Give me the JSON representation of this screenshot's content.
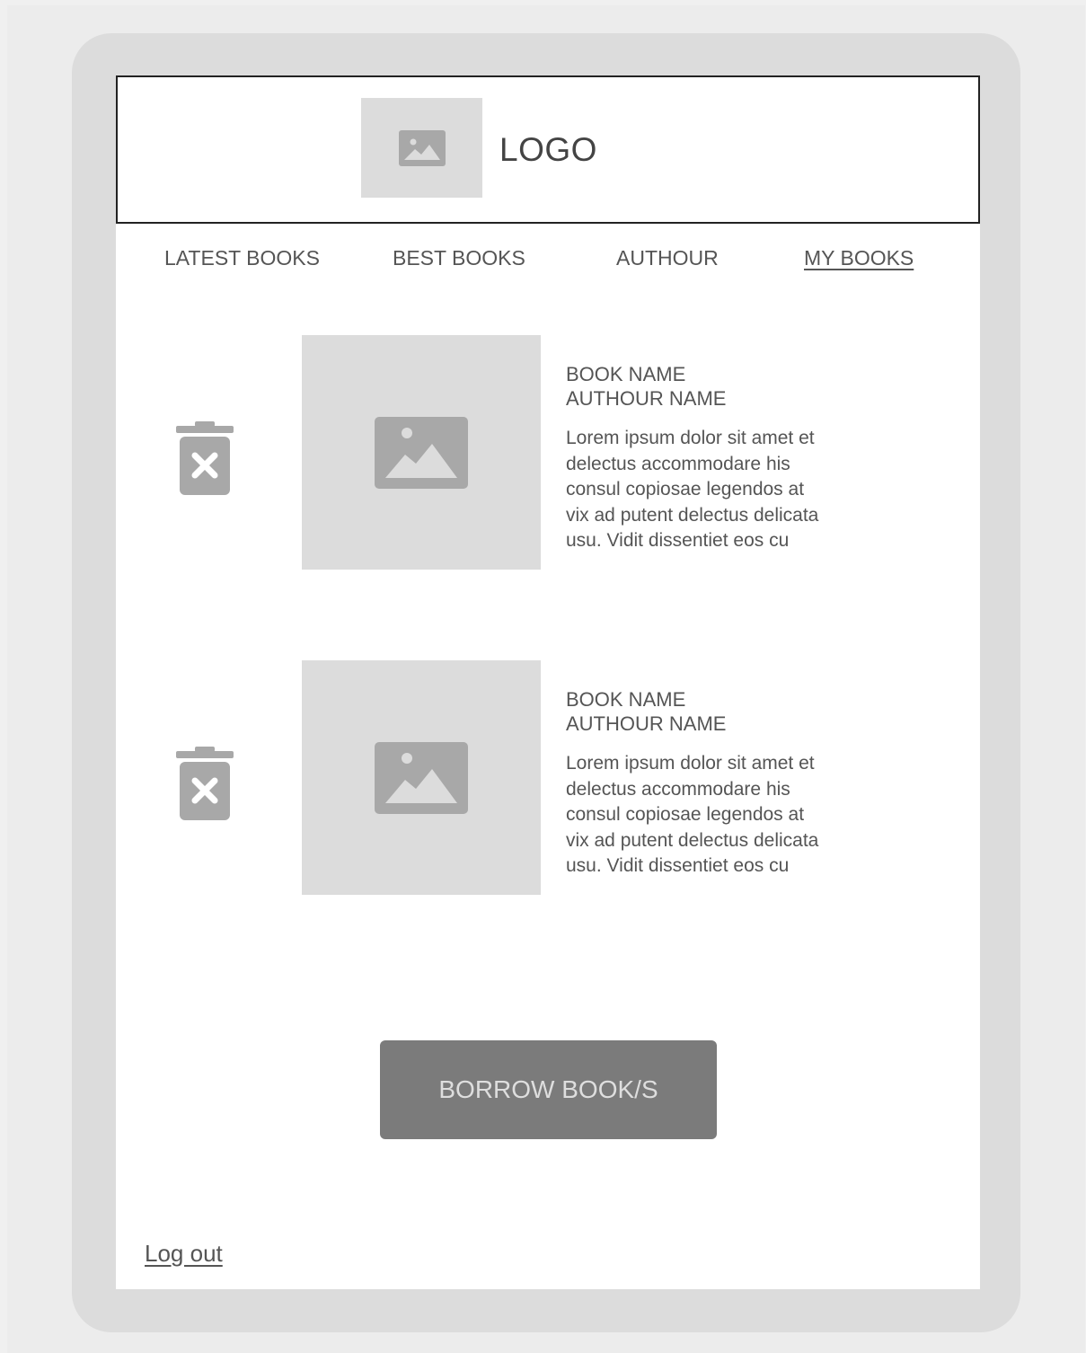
{
  "header": {
    "logo_text": "LOGO",
    "logo_icon": "image-placeholder-icon"
  },
  "nav": {
    "items": [
      {
        "label": "LATEST BOOKS",
        "active": false
      },
      {
        "label": "BEST BOOKS",
        "active": false
      },
      {
        "label": "AUTHOUR",
        "active": false
      },
      {
        "label": "MY BOOKS",
        "active": true
      }
    ]
  },
  "books": [
    {
      "name": "BOOK NAME",
      "author": "AUTHOUR NAME",
      "description_lines": [
        "Lorem ipsum dolor sit amet et",
        "delectus accommodare his",
        "consul copiosae legendos at",
        "vix ad putent delectus delicata",
        "usu. Vidit dissentiet eos cu"
      ],
      "remove_icon": "trash-x-icon",
      "cover_icon": "image-placeholder-icon"
    },
    {
      "name": "BOOK NAME",
      "author": "AUTHOUR NAME",
      "description_lines": [
        "Lorem ipsum dolor sit amet et",
        "delectus accommodare his",
        "consul copiosae legendos at",
        "vix ad putent delectus delicata",
        "usu. Vidit dissentiet eos cu"
      ],
      "remove_icon": "trash-x-icon",
      "cover_icon": "image-placeholder-icon"
    }
  ],
  "actions": {
    "borrow_label": "BORROW BOOK/S",
    "logout_label": "Log out"
  },
  "colors": {
    "placeholder": "#dcdcdc",
    "icon": "#a8a8a8",
    "button": "#7b7b7b",
    "text": "#555555"
  }
}
